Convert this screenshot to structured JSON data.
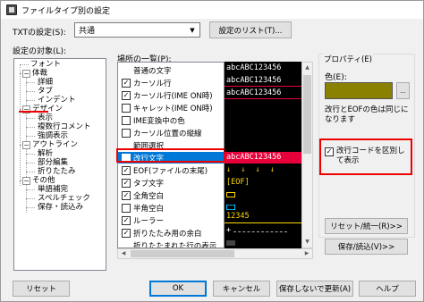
{
  "window": {
    "title": "ファイルタイプ別の設定"
  },
  "filetype": {
    "label": "TXTの設定(S):",
    "value": "共通",
    "list_button": "設定のリスト(T)..."
  },
  "target": {
    "label": "設定の対象(L):",
    "tree": [
      "フォント",
      "体裁",
      "詳細",
      "タブ",
      "インデント",
      "デザイン",
      "表示",
      "複数行コメント",
      "強調表示",
      "アウトライン",
      "解析",
      "部分編集",
      "折りたたみ",
      "その他",
      "単語補完",
      "スペルチェック",
      "保存・読込み"
    ]
  },
  "places": {
    "label": "場所の一覧(P):",
    "items": [
      {
        "label": "普通の文字",
        "checkbox": false,
        "checked": false
      },
      {
        "label": "カーソル行",
        "checkbox": true,
        "checked": true
      },
      {
        "label": "カーソル行(IME ON時)",
        "checkbox": true,
        "checked": true
      },
      {
        "label": "キャレット(IME ON時)",
        "checkbox": true,
        "checked": false
      },
      {
        "label": "IME変換中の色",
        "checkbox": true,
        "checked": false
      },
      {
        "label": "カーソル位置の縦線",
        "checkbox": true,
        "checked": false
      },
      {
        "label": "範囲選択",
        "checkbox": false,
        "checked": false
      },
      {
        "label": "改行文字",
        "checkbox": true,
        "checked": true
      },
      {
        "label": "EOF(ファイルの末尾)",
        "checkbox": true,
        "checked": true
      },
      {
        "label": "タブ文字",
        "checkbox": true,
        "checked": true
      },
      {
        "label": "全角空白",
        "checkbox": true,
        "checked": true
      },
      {
        "label": "半角空白",
        "checkbox": true,
        "checked": false
      },
      {
        "label": "ルーラー",
        "checkbox": true,
        "checked": true
      },
      {
        "label": "折りたたみ用の余白",
        "checkbox": true,
        "checked": true
      },
      {
        "label": "折りたたまれた行の表示",
        "checkbox": false,
        "checked": false
      }
    ],
    "selected_index": 7
  },
  "preview": {
    "lines": [
      {
        "text": "abcABC123456",
        "color": "#ffffff",
        "bg": "#000000"
      },
      {
        "text": "abcABC123456",
        "color": "#ffffff",
        "bg": "#000000"
      },
      {
        "text": "abcABC123456",
        "color": "#ffffff",
        "bg": "#000000"
      },
      {
        "text": "",
        "color": "#ffffff",
        "bg": "#000000"
      },
      {
        "text": "",
        "color": "#ffffff",
        "bg": "#000000"
      },
      {
        "text": "",
        "color": "#ffffff",
        "bg": "#000000"
      },
      {
        "text": "abcABC123456",
        "color": "#ffffff",
        "bg": "#e8003a"
      },
      {
        "text": "↓ ↓ ↓ ↓",
        "color": "#ffd800",
        "bg": "#000000"
      },
      {
        "text": "[EOF]",
        "color": "#ffd800",
        "bg": "#000000"
      },
      {
        "text": "",
        "color": "#ffffff",
        "bg": "#000000"
      },
      {
        "text": "",
        "color": "#ffffff",
        "bg": "#000000"
      },
      {
        "text": "",
        "color": "#ffffff",
        "bg": "#000000"
      },
      {
        "text": "12345",
        "color": "#ffd800",
        "bg": "#000000"
      },
      {
        "text": "+",
        "color": "#ffffff",
        "bg": "#000000"
      },
      {
        "text": "",
        "color": "#ffffff",
        "bg": "#000000"
      }
    ]
  },
  "property": {
    "group_label": "プロパティ(E)",
    "color_label": "色(E):",
    "swatch_color": "#8b8100",
    "dots": "...",
    "note": "改行とEOFの色は同じになります",
    "checkbox_label": "改行コードを区別して表示",
    "checkbox_checked": true
  },
  "side_buttons": {
    "reset_unify": "リセット/統一(R)>>",
    "save_load": "保存/読込(V)>>"
  },
  "bottom": {
    "reset": "リセット",
    "ok": "OK",
    "cancel": "キャンセル",
    "nosave": "保存しないで更新(A)",
    "help": "ヘルプ"
  },
  "colors": {
    "highlight_red": "#e00000",
    "selection_blue": "#0078d7"
  }
}
